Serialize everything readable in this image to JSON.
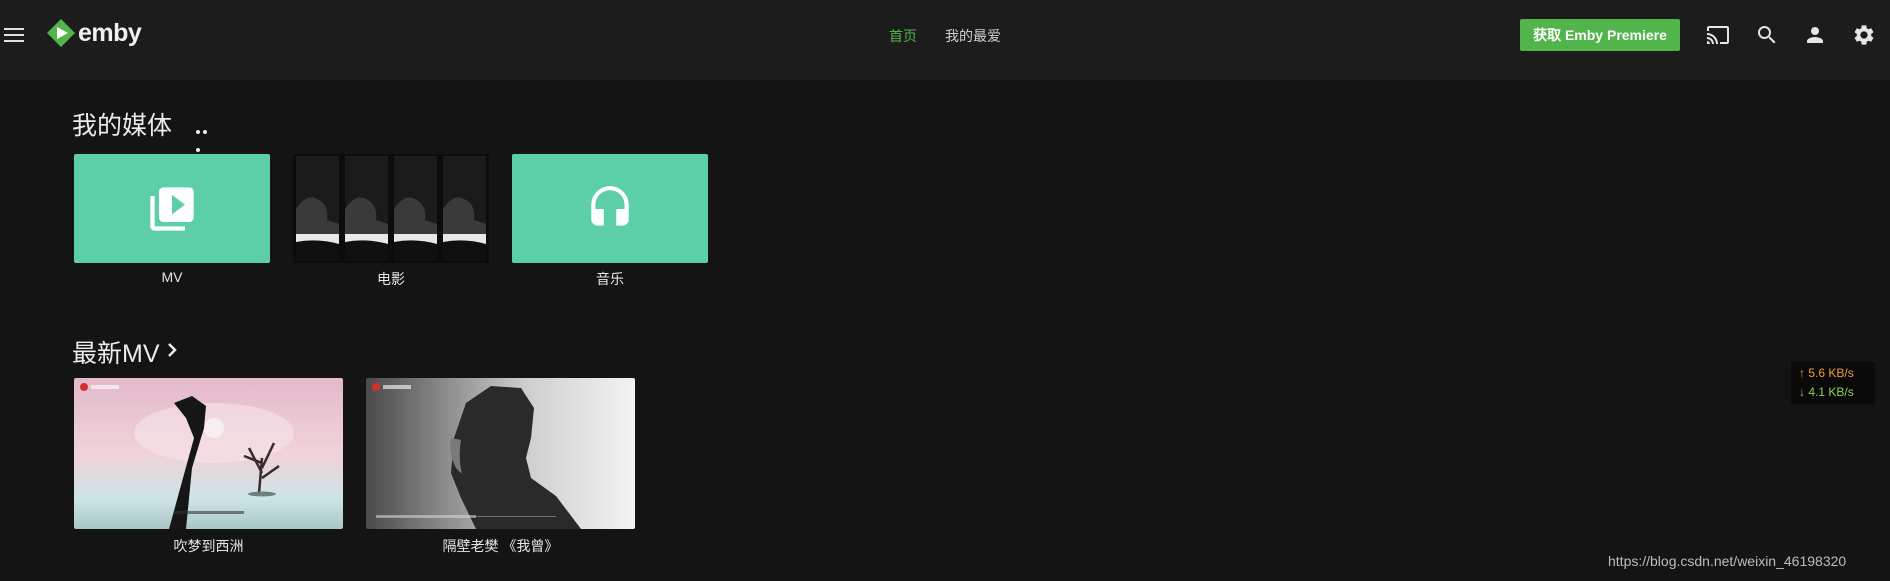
{
  "header": {
    "logo_text": "emby",
    "nav": [
      {
        "label": "首页",
        "active": true
      },
      {
        "label": "我的最爱",
        "active": false
      }
    ],
    "premiere_label": "获取 Emby Premiere",
    "icons": [
      "cast-icon",
      "search-icon",
      "user-icon",
      "settings-icon"
    ],
    "accent_color": "#52b54b"
  },
  "my_media": {
    "title": "我的媒体",
    "items": [
      {
        "label": "MV",
        "icon": "video-library-icon",
        "color": "#5ccfa9"
      },
      {
        "label": "电影",
        "icon": "collage-thumbnail"
      },
      {
        "label": "音乐",
        "icon": "headphones-icon",
        "color": "#5ccfa9"
      }
    ]
  },
  "latest_mv": {
    "title": "最新MV",
    "items": [
      {
        "label": "吹梦到西洲"
      },
      {
        "label": "隔壁老樊 《我曾》"
      }
    ]
  },
  "network_speed": {
    "upload": "↑ 5.6 KB/s",
    "download": "↓ 4.1 KB/s"
  },
  "watermark": "https://blog.csdn.net/weixin_46198320"
}
